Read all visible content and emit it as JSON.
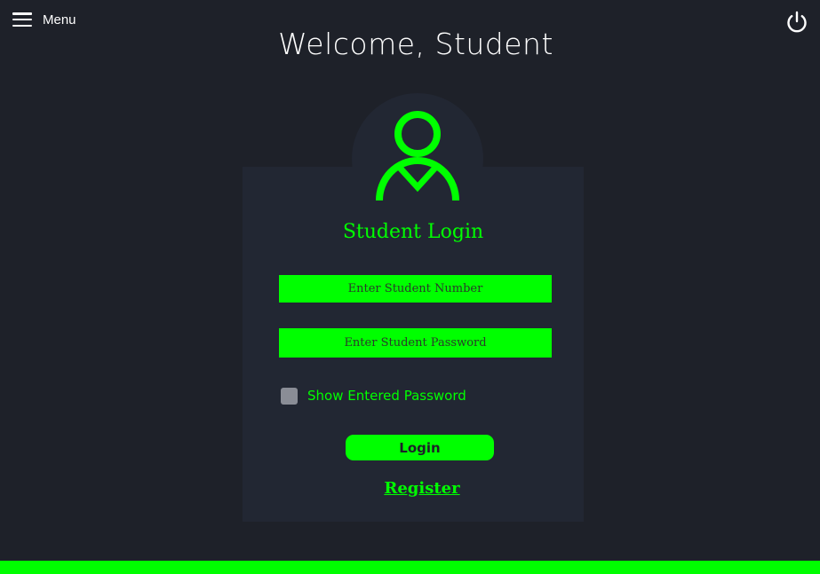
{
  "topbar": {
    "menu_label": "Menu",
    "menu_icon": "hamburger-icon",
    "power_icon": "power-icon"
  },
  "page": {
    "title": "Welcome, Student"
  },
  "login": {
    "avatar_icon": "user-icon",
    "title": "Student Login",
    "student_number_placeholder": "Enter Student Number",
    "student_number_value": "",
    "password_placeholder": "Enter Student Password",
    "password_value": "",
    "show_password_label": "Show Entered Password",
    "show_password_checked": false,
    "login_label": "Login",
    "register_label": "Register"
  },
  "colors": {
    "background": "#1e2129",
    "card": "#222733",
    "accent": "#00ff00",
    "text": "#ffffff"
  }
}
